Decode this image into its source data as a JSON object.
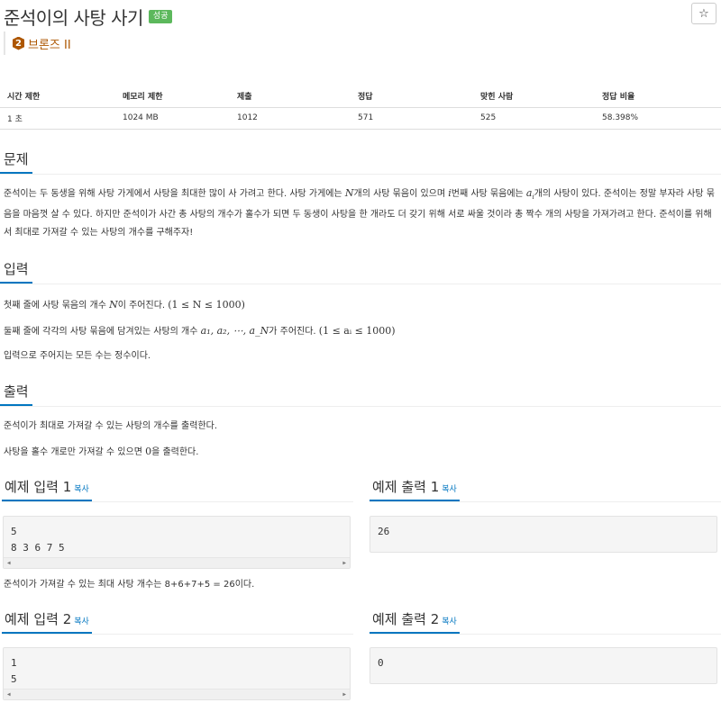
{
  "title": "준석이의 사탕 사기",
  "status_badge": "성공",
  "star_icon": "☆",
  "tier": {
    "number": "2",
    "label": "브론즈 II",
    "color": "#ad5600"
  },
  "info_table": {
    "headers": [
      "시간 제한",
      "메모리 제한",
      "제출",
      "정답",
      "맞힌 사람",
      "정답 비율"
    ],
    "values": [
      "1 초",
      "1024 MB",
      "1012",
      "571",
      "525",
      "58.398%"
    ]
  },
  "sections": {
    "problem": {
      "heading": "문제",
      "p1": "준석이는 두 동생을 위해 사탕 가게에서 사탕을 최대한 많이 사 가려고 한다. 사탕 가게에는 ",
      "var_n": "N",
      "p2": "개의 사탕 묶음이 있으며 ",
      "var_i": "i",
      "p3": "번째 사탕 묶음에는 ",
      "var_ai": "a",
      "var_ai_sub": "i",
      "p4": "개의 사탕이 있다. 준석이는 정말 부자라 사탕 묶음을 마음껏 살 수 있다. 하지만 준석이가 사간 총 사탕의 개수가 홀수가 되면 두 동생이 사탕을 한 개라도 더 갖기 위해 서로 싸울 것이라 총 짝수 개의 사탕을 가져가려고 한다. 준석이를 위해서 최대로 가져갈 수 있는 사탕의 개수를 구해주자!"
    },
    "input": {
      "heading": "입력",
      "line1_text": "첫째 줄에 사탕 묶음의 개수 ",
      "line1_var": "N",
      "line1_text2": "이 주어진다. ",
      "line1_math": "(1 ≤ N ≤ 1000)",
      "line2_text": "둘째 줄에 각각의 사탕 묶음에 담겨있는 사탕의 개수 ",
      "line2_math": "a₁, a₂, ⋯, a_N",
      "line2_text2": "가 주어진다. ",
      "line2_math2": "(1 ≤ aᵢ ≤ 1000)",
      "line3": "입력으로 주어지는 모든 수는 정수이다."
    },
    "output": {
      "heading": "출력",
      "line1": "준석이가 최대로 가져갈 수 있는 사탕의 개수를 출력한다.",
      "line2_text": "사탕을 홀수 개로만 가져갈 수 있으면 ",
      "line2_math": "0",
      "line2_text2": "을 출력한다."
    }
  },
  "examples": [
    {
      "input_heading": "예제 입력 1",
      "output_heading": "예제 출력 1",
      "copy_label": "복사",
      "input_lines": "5\n8 3 6 7 5",
      "output_lines": "26",
      "note": "준석이가 가져갈 수 있는 최대 사탕 개수는 8+6+7+5 = 26이다."
    },
    {
      "input_heading": "예제 입력 2",
      "output_heading": "예제 출력 2",
      "copy_label": "복사",
      "input_lines": "1\n5",
      "output_lines": "0"
    }
  ],
  "colors": {
    "accent": "#0076c0",
    "success": "#5cb85c",
    "bronze": "#ad5600"
  }
}
